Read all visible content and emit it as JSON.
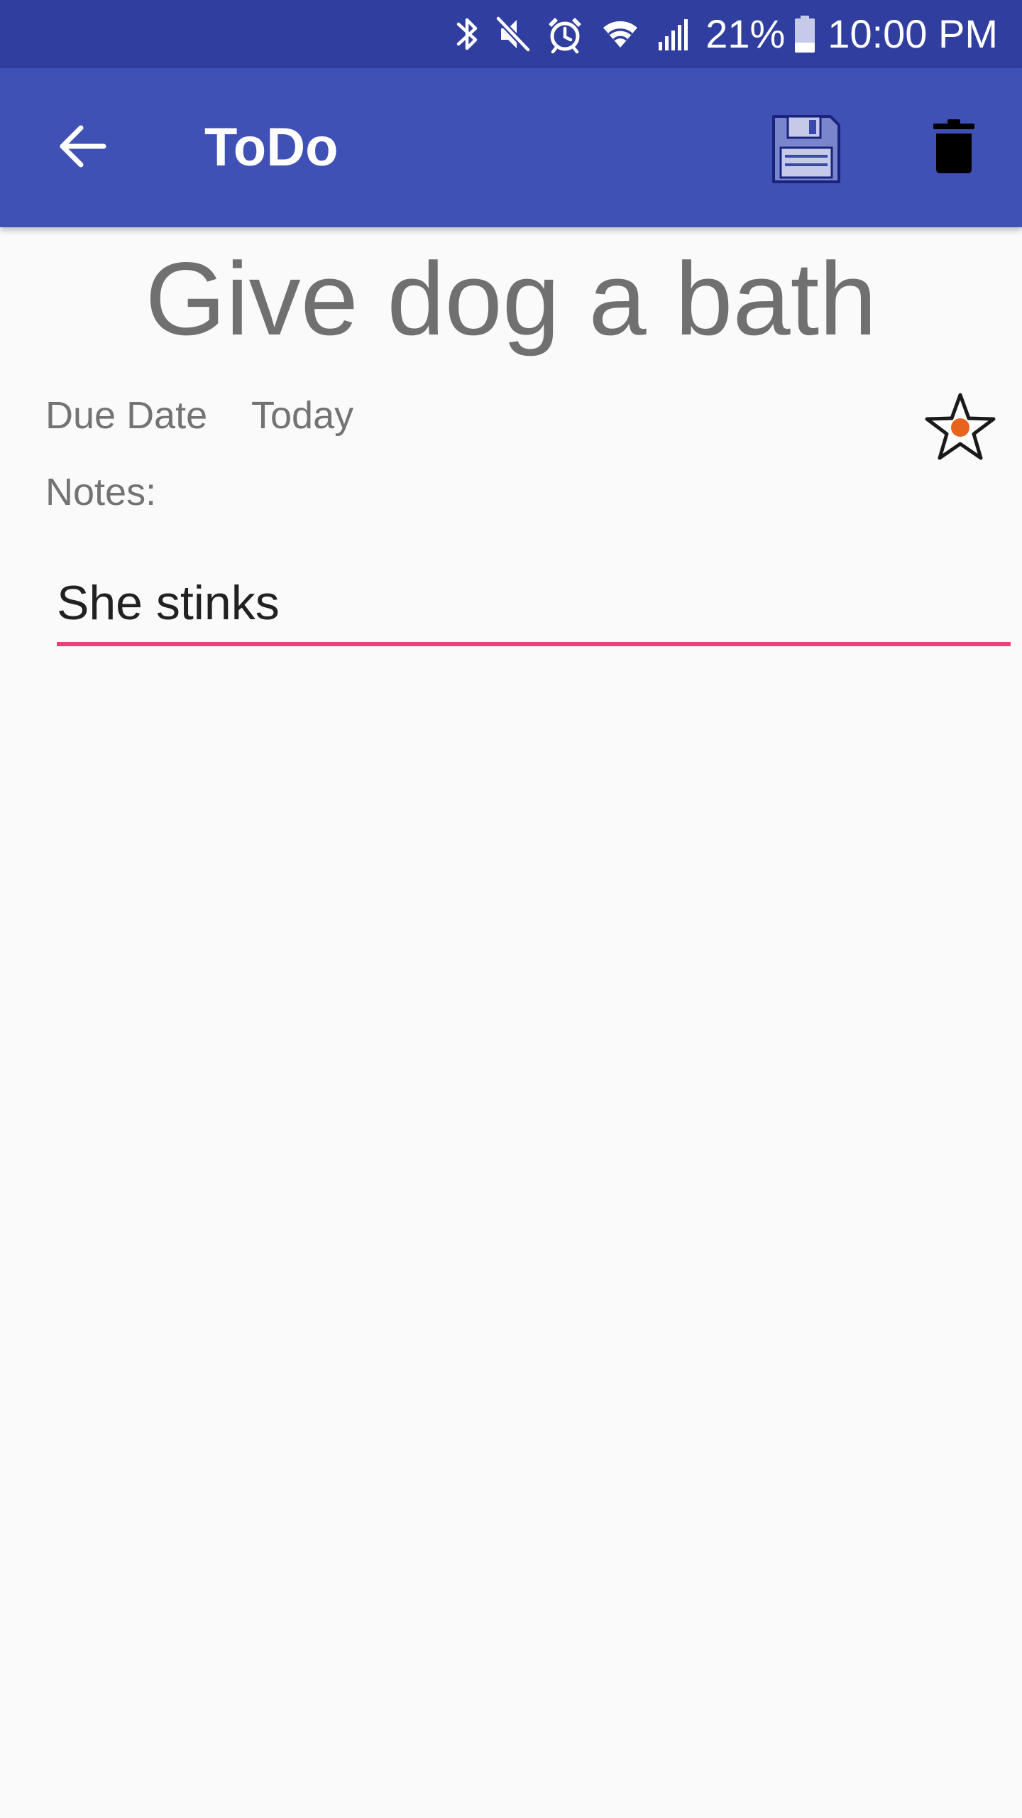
{
  "status_bar": {
    "battery_percent": "21%",
    "time": "10:00 PM",
    "icons": [
      "bluetooth-icon",
      "mute-icon",
      "alarm-icon",
      "wifi-icon",
      "signal-icon",
      "battery-icon"
    ]
  },
  "app_bar": {
    "title": "ToDo",
    "back_icon": "arrow-left-icon",
    "save_icon": "floppy-disk-icon",
    "delete_icon": "trash-icon"
  },
  "task": {
    "title": "Give dog a bath",
    "due_label": "Due Date",
    "due_value": "Today",
    "priority_icon": "star-icon",
    "notes_label": "Notes:",
    "notes_value": "She stinks"
  },
  "colors": {
    "status_bar": "#303f9f",
    "app_bar": "#3f51b5",
    "accent": "#ec407a",
    "star_dot": "#e8641e"
  }
}
